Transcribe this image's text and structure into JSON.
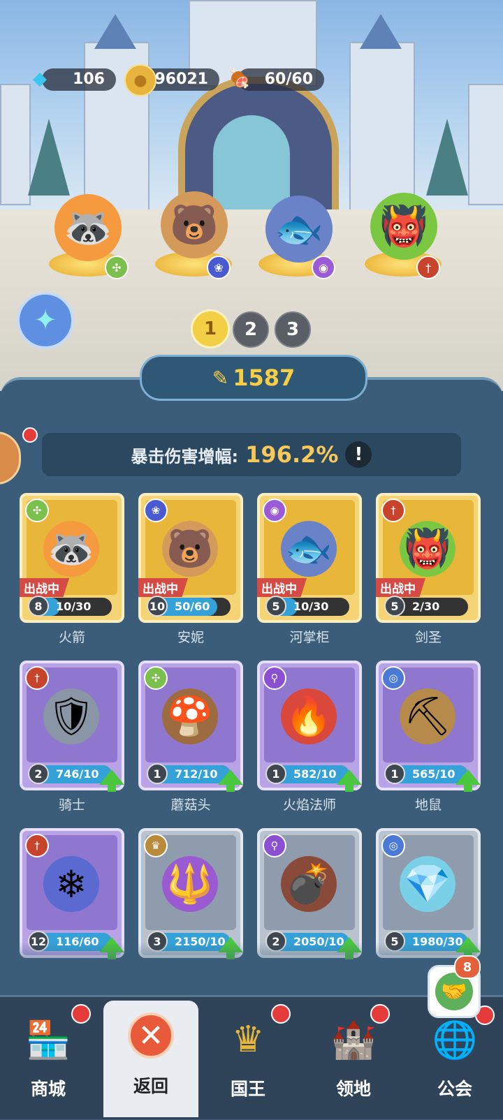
{
  "currency": {
    "gems": "106",
    "coins": "96021",
    "stamina": "60/60"
  },
  "team": {
    "pages": [
      "1",
      "2",
      "3"
    ],
    "active_page": "1",
    "power": "1587",
    "stat_label": "暴击伤害增幅:",
    "stat_value": "196.2%",
    "info_symbol": "!"
  },
  "heroes": [
    {
      "name": "火箭",
      "level": "8",
      "progress": "10/30",
      "fill": 0.33,
      "deployed_tag": "出战中",
      "rarity": "gold",
      "cls": "cross-arrows-icon"
    },
    {
      "name": "安妮",
      "level": "10",
      "progress": "50/60",
      "fill": 0.83,
      "deployed_tag": "出战中",
      "rarity": "gold",
      "cls": "paw-icon"
    },
    {
      "name": "河掌柜",
      "level": "5",
      "progress": "10/30",
      "fill": 0.33,
      "deployed_tag": "出战中",
      "rarity": "gold",
      "cls": "eye-icon"
    },
    {
      "name": "剑圣",
      "level": "5",
      "progress": "2/30",
      "fill": 0.07,
      "deployed_tag": "出战中",
      "rarity": "gold",
      "cls": "sword-icon"
    },
    {
      "name": "骑士",
      "level": "2",
      "progress": "746/10",
      "fill": 1,
      "rarity": "purple",
      "cls": "sword-icon"
    },
    {
      "name": "蘑菇头",
      "level": "1",
      "progress": "712/10",
      "fill": 1,
      "rarity": "purple",
      "cls": "cross-arrows-icon"
    },
    {
      "name": "火焰法师",
      "level": "1",
      "progress": "582/10",
      "fill": 1,
      "rarity": "purple",
      "cls": "staff-icon"
    },
    {
      "name": "地鼠",
      "level": "1",
      "progress": "565/10",
      "fill": 1,
      "rarity": "purple",
      "cls": "spiral-icon"
    },
    {
      "name": "",
      "level": "12",
      "progress": "116/60",
      "fill": 1,
      "rarity": "purple",
      "cls": "sword-icon"
    },
    {
      "name": "",
      "level": "3",
      "progress": "2150/10",
      "fill": 1,
      "rarity": "grey",
      "cls": "crown-icon"
    },
    {
      "name": "",
      "level": "2",
      "progress": "2050/10",
      "fill": 1,
      "rarity": "grey",
      "cls": "staff-icon"
    },
    {
      "name": "",
      "level": "5",
      "progress": "1980/30",
      "fill": 1,
      "rarity": "grey",
      "cls": "spiral-icon"
    }
  ],
  "nav": {
    "shop": "商城",
    "back": "返回",
    "king": "国王",
    "territory": "领地",
    "guild": "公会",
    "guild_badge": "8"
  }
}
